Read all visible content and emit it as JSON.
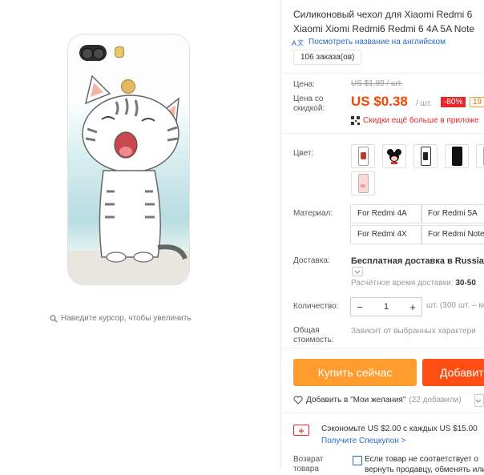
{
  "product": {
    "title_line1": "Силиконовый чехол для Xiaomi Redmi 6",
    "title_line2": "Xiaomi Xiomi Redmi6 Redmi 6 4A 5A Note",
    "translate_link": "Посмотреть название на английском",
    "orders": "106 заказа(ов)"
  },
  "gallery": {
    "zoom_hint": "Наведите курсор, чтобы увеличить"
  },
  "price": {
    "label_price": "Цена:",
    "old_price": "US $1.89 / шт.",
    "label_discount_line1": "Цена со",
    "label_discount_line2": "скидкой:",
    "new_price": "US $0.38",
    "per_unit": "/ шт.",
    "discount_badge": "-80%",
    "extra_badge": "19",
    "app_promo": "Скидки ещё больше в приложе"
  },
  "color": {
    "label": "Цвет:",
    "swatch_count": 7
  },
  "material": {
    "label": "Материал:",
    "options": [
      "For Redmi 4A",
      "For Redmi 5A",
      "For Redmi 4X",
      "For Redmi Note"
    ]
  },
  "shipping": {
    "label": "Доставка:",
    "method": "Бесплатная доставка в Russian F",
    "time_label": "Расчётное время доставки:",
    "time_value": "30-50"
  },
  "quantity": {
    "label": "Количество:",
    "value": "1",
    "minus": "−",
    "plus": "+",
    "note": "шт. (300 шт. – м"
  },
  "total": {
    "label_line1": "Общая",
    "label_line2": "стоимость:",
    "note": "Зависит от выбранных характери"
  },
  "actions": {
    "buy_now": "Купить сейчас",
    "add_to_cart": "Добавит",
    "wishlist": "Добавить в \"Мои желания\"",
    "wishlist_count": "(22 добавили)"
  },
  "coupon": {
    "save_text": "Сэкономьте US $2.00 с каждых US $15.00",
    "link": "Получите Спецкупон >"
  },
  "returns": {
    "label_line1": "Возврат",
    "label_line2": "товара",
    "text_line1": "Если товар не соответствует о",
    "text_line2": "вернуть продавцу, обменять или"
  },
  "colors": {
    "accent_orange": "#ff4400",
    "buy_button": "#ff9c2e",
    "cart_button": "#ff4e14",
    "link_blue": "#2a6ac8",
    "discount_red": "#e6272b"
  }
}
